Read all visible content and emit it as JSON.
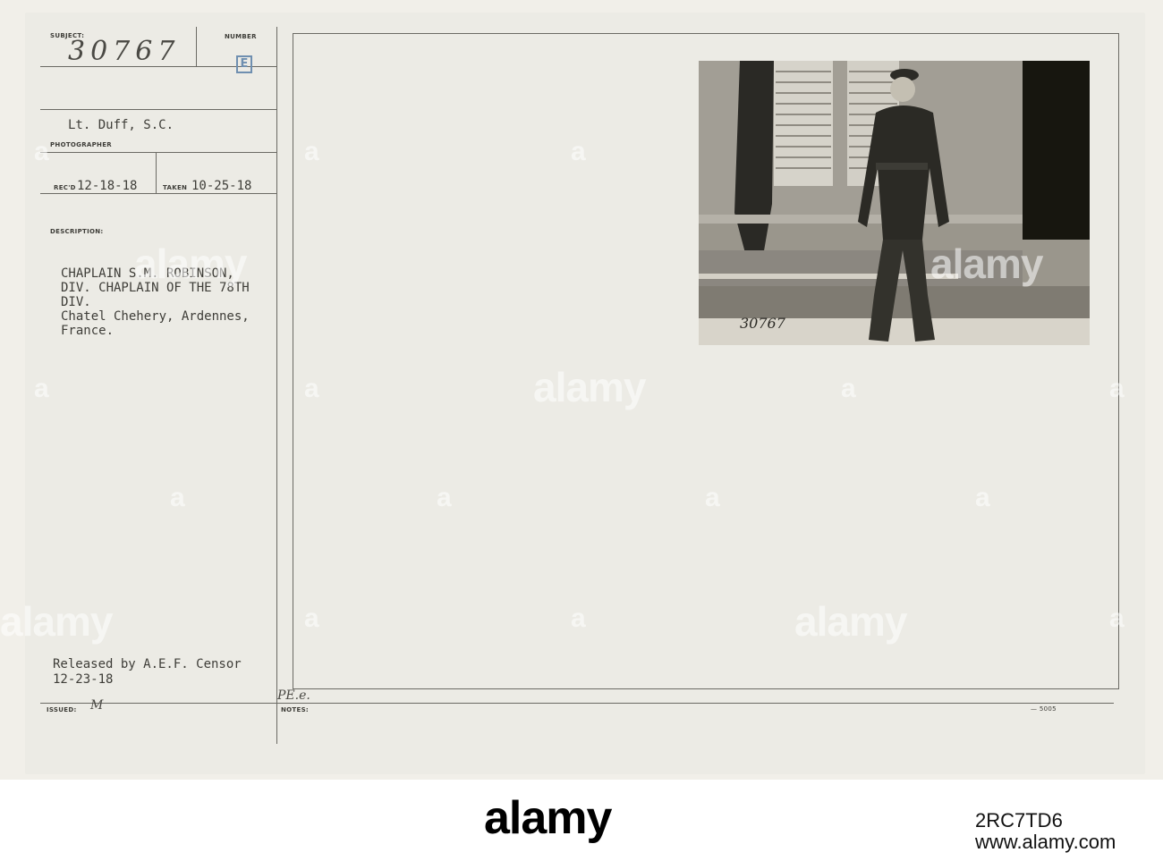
{
  "record": {
    "subject_label": "SUBJECT:",
    "number_label": "NUMBER",
    "subject_number": "30767",
    "number_stamp": "E",
    "photographer_name": "Lt. Duff, S.C.",
    "photographer_label": "PHOTOGRAPHER",
    "recd_label": "REC'D",
    "recd_date": "12-18-18",
    "taken_label": "TAKEN",
    "taken_date": "10-25-18",
    "description_label": "DESCRIPTION:",
    "description_lines": [
      "CHAPLAIN S.M. ROBINSON,",
      "DIV. CHAPLAIN OF THE 78TH",
      "DIV.",
      "Chatel Chehery, Ardennes,",
      "France."
    ],
    "release_line": "Released by A.E.F. Censor",
    "release_date": "12-23-18",
    "issued_label": "ISSUED:",
    "issued_mark": "M",
    "notes_label": "NOTES:",
    "pe_mark": "PE.e.",
    "form_code": "— 5005"
  },
  "photo": {
    "handwritten_number": "30767"
  },
  "watermark": {
    "text": "alamy",
    "glyph": "a"
  },
  "footer": {
    "logo": "alamy",
    "image_id": "2RC7TD6",
    "url": "www.alamy.com"
  }
}
